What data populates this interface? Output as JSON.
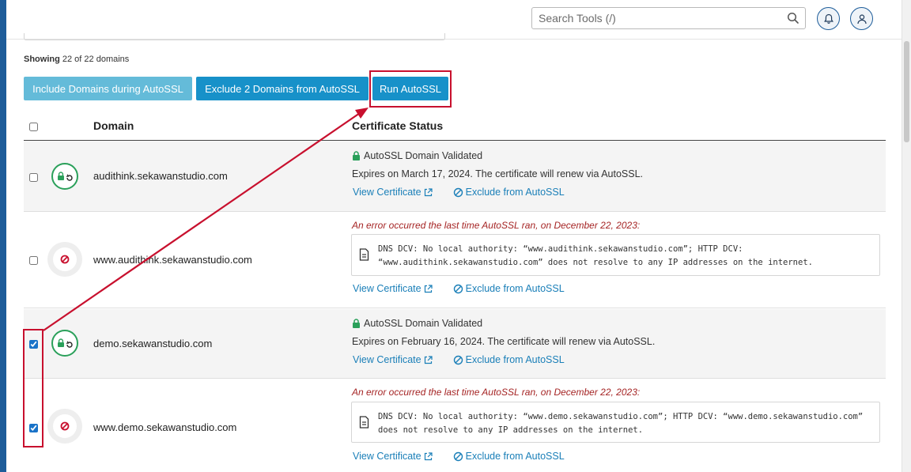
{
  "search": {
    "placeholder": "Search Tools (/)"
  },
  "summary": {
    "prefix": "Showing",
    "count_text": "22 of 22 domains"
  },
  "actions": {
    "include_label": "Include Domains during AutoSSL",
    "exclude_label": "Exclude 2 Domains from AutoSSL",
    "run_label": "Run AutoSSL"
  },
  "table": {
    "col_domain": "Domain",
    "col_status": "Certificate Status",
    "view_label": "View Certificate",
    "exclude_link_label": "Exclude from AutoSSL",
    "rows": [
      {
        "domain": "audithink.sekawanstudio.com",
        "status": "AutoSSL Domain Validated",
        "detail": "Expires on March 17, 2024. The certificate will renew via AutoSSL."
      },
      {
        "domain": "www.audithink.sekawanstudio.com",
        "error": "An error occurred the last time AutoSSL ran, on December 22, 2023:",
        "log": "DNS DCV: No local authority: “www.audithink.sekawanstudio.com”; HTTP DCV: “www.audithink.sekawanstudio.com” does not resolve to any IP addresses on the internet."
      },
      {
        "domain": "demo.sekawanstudio.com",
        "status": "AutoSSL Domain Validated",
        "detail": "Expires on February 16, 2024. The certificate will renew via AutoSSL."
      },
      {
        "domain": "www.demo.sekawanstudio.com",
        "error": "An error occurred the last time AutoSSL ran, on December 22, 2023:",
        "log": "DNS DCV: No local authority: “www.demo.sekawanstudio.com”; HTTP DCV: “www.demo.sekawanstudio.com” does not resolve to any IP addresses on the internet."
      }
    ]
  },
  "colors": {
    "brand": "#1e5d9a",
    "button": "#1791c9",
    "button_disabled": "#64bbd9",
    "success": "#2aa05a",
    "error": "#c8102e",
    "annotation": "#c8102e",
    "link": "#1a7fb8"
  },
  "icons": {
    "search": "search-icon",
    "notifications": "bell-icon",
    "account": "user-icon",
    "validated": "lock-icon",
    "error": "no-entry-icon",
    "external": "external-link-icon",
    "exclude": "ban-icon",
    "log": "document-icon"
  }
}
